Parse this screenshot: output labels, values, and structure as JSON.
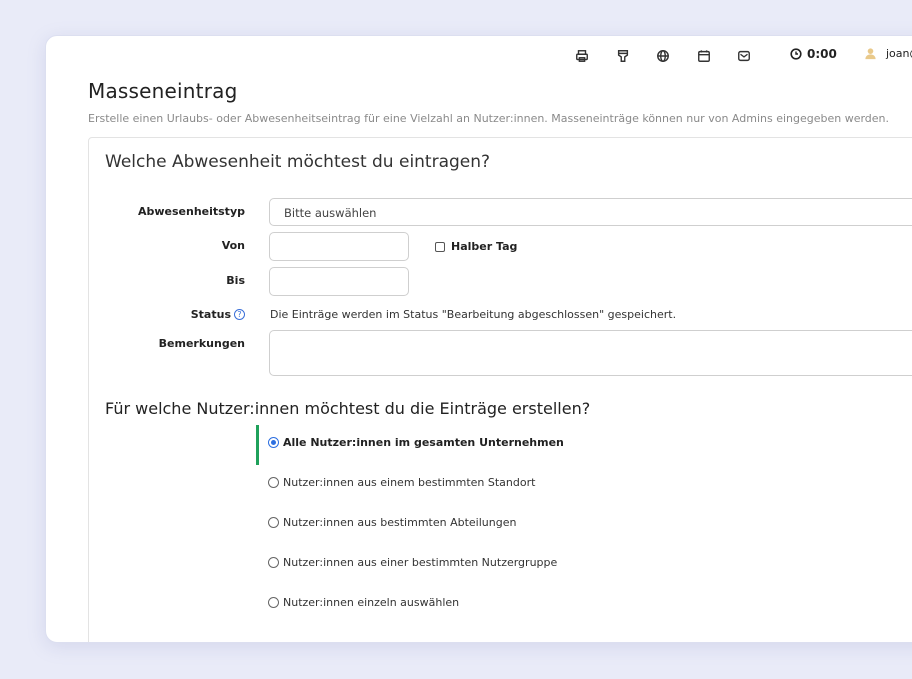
{
  "topbar": {
    "icons": [
      "printer-icon",
      "badge-icon",
      "globe-icon",
      "calendar-icon",
      "inbox-icon"
    ],
    "timer": "0:00",
    "user": "joan@"
  },
  "page": {
    "title": "Masseneintrag",
    "subtitle": "Erstelle einen Urlaubs- oder Abwesenheitseintrag für eine Vielzahl an Nutzer:innen. Masseneinträge können nur von Admins eingegeben werden."
  },
  "form": {
    "heading": "Welche Abwesenheit möchtest du eintragen?",
    "type_label": "Abwesenheitstyp",
    "type_value": "Bitte auswählen",
    "from_label": "Von",
    "from_value": "",
    "half_day_label": "Halber Tag",
    "to_label": "Bis",
    "to_value": "",
    "status_label": "Status",
    "status_text": "Die Einträge werden im Status \"Bearbeitung abgeschlossen\" gespeichert.",
    "remarks_label": "Bemerkungen",
    "remarks_value": ""
  },
  "users": {
    "heading": "Für welche Nutzer:innen möchtest du die Einträge erstellen?",
    "options": [
      {
        "label": "Alle Nutzer:innen im gesamten Unternehmen",
        "selected": true
      },
      {
        "label": "Nutzer:innen aus einem bestimmten Standort",
        "selected": false
      },
      {
        "label": "Nutzer:innen aus bestimmten Abteilungen",
        "selected": false
      },
      {
        "label": "Nutzer:innen aus einer bestimmten Nutzergruppe",
        "selected": false
      },
      {
        "label": "Nutzer:innen einzeln auswählen",
        "selected": false
      }
    ]
  },
  "colors": {
    "accent": "#2d6fe0",
    "selected_bar": "#1fa15b",
    "background": "#e9ebf8"
  }
}
